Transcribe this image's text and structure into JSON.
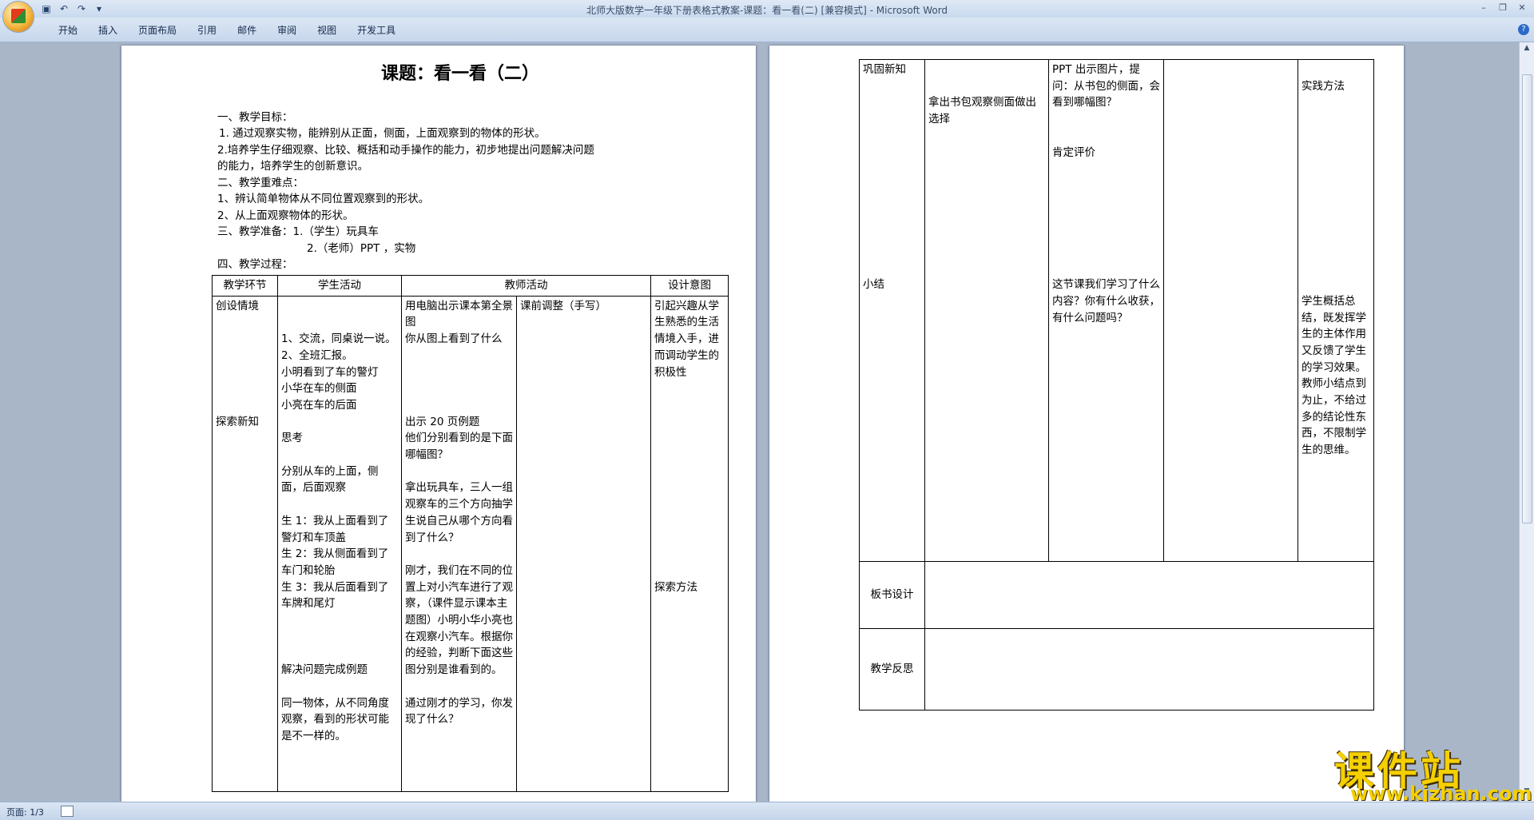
{
  "window": {
    "title": "北师大版数学一年级下册表格式教案-课题：看一看(二) [兼容模式] - Microsoft Word"
  },
  "ribbon": {
    "tabs": [
      "开始",
      "插入",
      "页面布局",
      "引用",
      "邮件",
      "审阅",
      "视图",
      "开发工具"
    ]
  },
  "status": {
    "page": "页面: 1/3"
  },
  "page1": {
    "title": "课题：看一看（二）",
    "lines": [
      "一、教学目标：",
      "1. 通过观察实物，能辨别从正面，侧面，上面观察到的物体的形状。",
      "2.培养学生仔细观察、比较、概括和动手操作的能力，初步地提出问题解决问题",
      "的能力，培养学生的创新意识。",
      "二、教学重难点：",
      "1、辨认简单物体从不同位置观察到的形状。",
      "2、从上面观察物体的形状。",
      "三、教学准备：1.（学生）玩具车",
      "2.（老师）PPT ，实物",
      "四、教学过程："
    ],
    "table": {
      "headers": [
        "教学环节",
        "学生活动",
        "教师活动",
        "设计意图"
      ],
      "col1": "创设情境\n\n\n\n\n\n\n探索新知",
      "col2": "\n\n1、交流，同桌说一说。\n2、全班汇报。\n小明看到了车的警灯\n小华在车的侧面\n小亮在车的后面\n\n思考\n\n分别从车的上面，侧面，后面观察\n\n生 1：我从上面看到了警灯和车顶盖\n生 2：我从侧面看到了车门和轮胎\n生 3：我从后面看到了车牌和尾灯\n\n\n\n解决问题完成例题\n\n同一物体，从不同角度观察，看到的形状可能是不一样的。",
      "col3": "用电脑出示课本第全景图\n你从图上看到了什么\n\n\n\n\n出示 20 页例题\n他们分别看到的是下面哪幅图？\n\n拿出玩具车，三人一组观察车的三个方向抽学生说自己从哪个方向看到了什么？\n\n刚才，我们在不同的位置上对小汽车进行了观察，（课件显示课本主题图）小明小华小亮也在观察小汽车。根据你的经验，判断下面这些图分别是谁看到的。\n\n通过刚才的学习，你发现了什么？",
      "col4": "课前调整（手写）",
      "col5": "引起兴趣从学生熟悉的生活情境入手，进而调动学生的积极性\n\n\n\n\n\n\n\n\n\n\n\n\n探索方法"
    }
  },
  "page2": {
    "table": {
      "col1": "巩固新知\n\n\n\n\n\n\n\n\n\n\n\n\n小结",
      "col2": "\n\n拿出书包观察侧面做出选择",
      "col3": "PPT 出示图片，提问：从书包的侧面，会看到哪幅图？\n\n\n肯定评价\n\n\n\n\n\n\n\n这节课我们学习了什么内容？你有什么收获，有什么问题吗？",
      "col4": "",
      "col5": "\n实践方法\n\n\n\n\n\n\n\n\n\n\n\n\n学生概括总结，既发挥学生的主体作用又反馈了学生的学习效果。教师小结点到为止，不给过多的结论性东西，不限制学生的思维。",
      "board_label": "板书设计",
      "reflect_label": "教学反思"
    }
  },
  "watermark": {
    "cn": "课件站",
    "url": "www.kjzhan.com"
  }
}
